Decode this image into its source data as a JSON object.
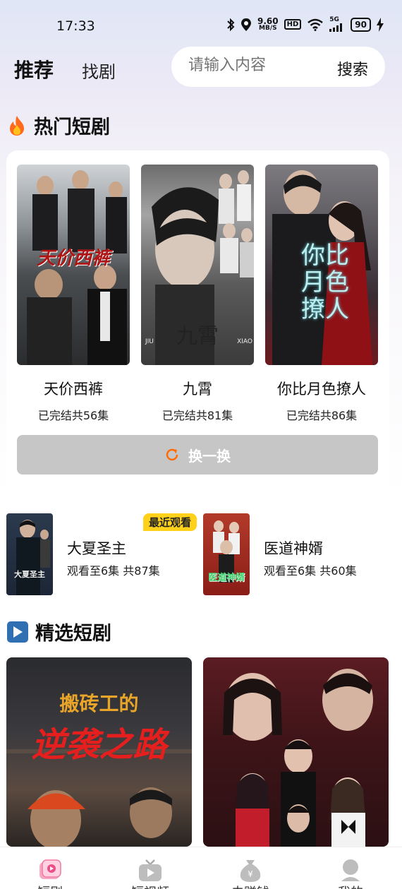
{
  "status_bar": {
    "time": "17:33",
    "net_speed_value": "9.60",
    "net_speed_unit": "MB/S",
    "hd_label": "HD",
    "signal_label": "5G",
    "battery": "90"
  },
  "top_nav": {
    "tab_recommend": "推荐",
    "tab_find": "找剧",
    "search_placeholder": "请输入内容",
    "search_button": "搜索"
  },
  "hot_section": {
    "title": "热门短剧",
    "items": [
      {
        "name": "天价西裤",
        "episodes": "已完结共56集",
        "poster_text": "天价西裤"
      },
      {
        "name": "九霄",
        "episodes": "已完结共81集",
        "poster_text": "九霄",
        "poster_sub_left": "JIU",
        "poster_sub_right": "XIAO"
      },
      {
        "name": "你比月色撩人",
        "episodes": "已完结共86集",
        "poster_text": "你比月色撩人"
      }
    ],
    "refresh_label": "换一换"
  },
  "recent": {
    "badge": "最近观看",
    "items": [
      {
        "name": "大夏圣主",
        "progress": "观看至6集 共87集",
        "poster_text": "大夏圣主"
      },
      {
        "name": "医道神婿",
        "progress": "观看至6集 共60集",
        "poster_text": "医道神婿"
      }
    ]
  },
  "featured_section": {
    "title": "精选短剧",
    "items": [
      {
        "poster_line1": "搬砖工的",
        "poster_line2": "逆袭之路"
      },
      {
        "poster_line1": ""
      }
    ]
  },
  "bottom_nav": {
    "items": [
      {
        "label": "短剧",
        "icon": "drama-icon"
      },
      {
        "label": "短视频",
        "icon": "tv-icon"
      },
      {
        "label": "去赚钱",
        "icon": "money-bag-icon"
      },
      {
        "label": "我的",
        "icon": "user-icon"
      }
    ]
  },
  "colors": {
    "accent": "#ff6a00",
    "badge": "#ffd11a",
    "refresh_bg": "#c6c6c6"
  }
}
